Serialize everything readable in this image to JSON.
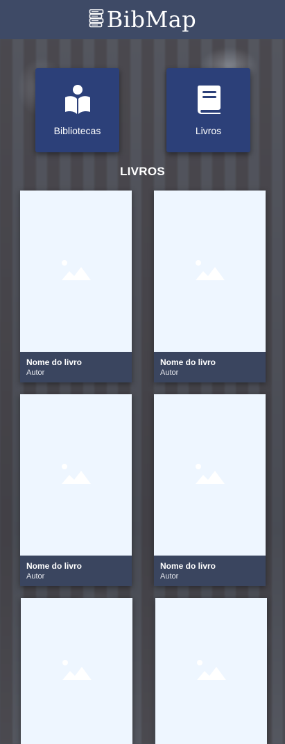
{
  "app": {
    "title": "BibMap"
  },
  "nav": {
    "libraries_label": "Bibliotecas",
    "books_label": "Livros"
  },
  "section": {
    "title": "LIVROS"
  },
  "books": [
    {
      "title": "Nome do livro",
      "author": "Autor"
    },
    {
      "title": "Nome do livro",
      "author": "Autor"
    },
    {
      "title": "Nome do livro",
      "author": "Autor"
    },
    {
      "title": "Nome do livro",
      "author": "Autor"
    },
    {
      "title": "",
      "author": ""
    },
    {
      "title": "",
      "author": ""
    }
  ],
  "colors": {
    "header": "#3e4a66",
    "nav_button": "#2c4079",
    "card_footer": "#3a455f",
    "card_image_bg": "#eef6ff"
  },
  "icons": {
    "logo": "book-stack-logo-icon",
    "libraries": "reader-book-icon",
    "books": "book-icon",
    "placeholder": "image-placeholder-icon"
  }
}
